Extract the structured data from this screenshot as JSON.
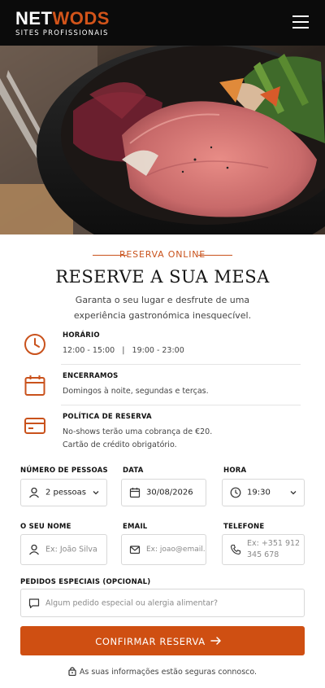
{
  "header": {
    "logo_net": "NET",
    "logo_wods": "WODS",
    "logo_sub": "SITES PROFISSIONAIS"
  },
  "section": {
    "eyebrow": "RESERVA ONLINE",
    "title": "RESERVE A SUA MESA",
    "lead": "Garanta o seu lugar e desfrute de uma experiência gastronómica inesquecível."
  },
  "info": {
    "hours": {
      "title": "HORÁRIO",
      "text": "12:00 - 15:00   |   19:00 - 23:00"
    },
    "closed": {
      "title": "ENCERRAMOS",
      "text": "Domingos à noite, segundas e terças."
    },
    "policy": {
      "title": "POLÍTICA DE RESERVA",
      "line1": "No-shows terão uma cobrança de €20.",
      "line2": "Cartão de crédito obrigatório."
    }
  },
  "form": {
    "people": {
      "label": "NÚMERO DE PESSOAS",
      "value": "2 pessoas"
    },
    "date": {
      "label": "DATA",
      "value": "30/08/2026"
    },
    "time": {
      "label": "HORA",
      "value": "19:30"
    },
    "name": {
      "label": "O SEU NOME",
      "placeholder": "Ex: João Silva"
    },
    "email": {
      "label": "EMAIL",
      "placeholder": "Ex: joao@email.com"
    },
    "phone": {
      "label": "TELEFONE",
      "placeholder_1": "Ex: +351 912",
      "placeholder_2": "345 678"
    },
    "requests": {
      "label": "PEDIDOS ESPECIAIS (OPCIONAL)",
      "placeholder": "Algum pedido especial ou alergia alimentar?"
    },
    "submit_label": "CONFIRMAR RESERVA",
    "secure_note": "As suas informações estão seguras connosco."
  },
  "colors": {
    "accent": "#cf4f12",
    "header_bg": "#0b0b0b"
  },
  "icons": [
    "menu-icon",
    "clock-icon",
    "calendar-icon",
    "credit-card-icon",
    "user-icon",
    "chevron-down-icon",
    "time-icon",
    "mail-icon",
    "phone-icon",
    "chat-icon",
    "arrow-right-icon",
    "lock-icon"
  ]
}
